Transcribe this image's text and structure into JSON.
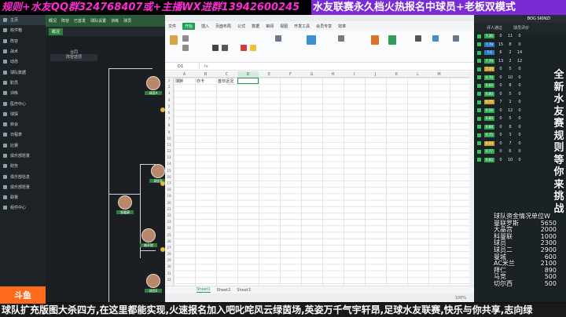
{
  "banner": {
    "left_text": "规则+水友QQ群324768407或+主播WX进群13942600245",
    "right_text": "水友联赛永久档火热报名中球员+老板双模式"
  },
  "sidebar": {
    "items": [
      {
        "label": "主页",
        "icon": "home-icon"
      },
      {
        "label": "收件箱",
        "icon": "inbox-icon"
      },
      {
        "label": "阵容",
        "icon": "squad-icon"
      },
      {
        "label": "战术",
        "icon": "tactics-icon"
      },
      {
        "label": "动态",
        "icon": "dynamics-icon"
      },
      {
        "label": "球队数据",
        "icon": "data-icon"
      },
      {
        "label": "职员",
        "icon": "staff-icon"
      },
      {
        "label": "训练",
        "icon": "training-icon"
      },
      {
        "label": "医疗中心",
        "icon": "medical-icon"
      },
      {
        "label": "球探",
        "icon": "scouting-icon"
      },
      {
        "label": "转会",
        "icon": "transfer-icon"
      },
      {
        "label": "日程表",
        "icon": "calendar-icon"
      },
      {
        "label": "比赛",
        "icon": "competitions-icon"
      },
      {
        "label": "俱乐部愿景",
        "icon": "vision-icon"
      },
      {
        "label": "财务",
        "icon": "finance-icon"
      },
      {
        "label": "俱乐部信息",
        "icon": "club-info-icon"
      },
      {
        "label": "俱乐部愿景",
        "icon": "vision2-icon"
      },
      {
        "label": "联赛",
        "icon": "league-icon"
      },
      {
        "label": "组件中心",
        "icon": "widgets-icon"
      }
    ],
    "logo_text": "斗鱼"
  },
  "game": {
    "tabs": [
      "概况",
      "阵容",
      "已首发",
      "球队设置",
      "训练",
      "球员"
    ],
    "subtab": "概况",
    "filter_label": "合同",
    "filter_value": "阵容选项",
    "players": [
      {
        "name": "球员A"
      },
      {
        "name": "球员B"
      },
      {
        "name": "张嘉豪"
      },
      {
        "name": "梅开地"
      },
      {
        "name": "球员E"
      }
    ]
  },
  "sheet": {
    "menu": [
      "文件",
      "开始",
      "插入",
      "页面布局",
      "公式",
      "数据",
      "审阅",
      "视图",
      "开发工具",
      "会员专享",
      "效率"
    ],
    "active_menu": "开始",
    "cell_ref": "D1",
    "fx": "fx",
    "columns": [
      "A",
      "B",
      "C",
      "D",
      "E",
      "F",
      "G",
      "H",
      "I",
      "J",
      "K",
      "L",
      "M"
    ],
    "selected_col": "D",
    "rows": [
      "1",
      "2",
      "3",
      "4",
      "5",
      "6",
      "7",
      "8",
      "9",
      "10",
      "11",
      "12",
      "13",
      "14",
      "15",
      "16",
      "17",
      "18",
      "19",
      "20",
      "21",
      "22",
      "23",
      "24",
      "25",
      "26",
      "27",
      "28",
      "29",
      "30",
      "31",
      "32"
    ],
    "cells": {
      "A1": "球胖",
      "B1": "亦卡",
      "C1": "首日近况"
    },
    "tabs": [
      "Sheet1",
      "Sheet2",
      "Sheet3"
    ],
    "active_tab": "Sheet1",
    "zoom": "100%"
  },
  "rpanel": {
    "header": "BOG SKINZI",
    "col_labels": [
      "评人通过",
      "球员评价"
    ],
    "rows": [
      {
        "rating": "7.36",
        "a": "0",
        "b": "11",
        "c": "0",
        "color": "#2fa84f"
      },
      {
        "rating": "7.79",
        "a": "15",
        "b": "8",
        "c": "0",
        "color": "#2a7ac7"
      },
      {
        "rating": "7.0",
        "a": "6",
        "b": "2",
        "c": "14",
        "color": "#2a7ac7"
      },
      {
        "rating": "7.79",
        "a": "13",
        "b": "2",
        "c": "12",
        "color": "#2fa84f"
      },
      {
        "rating": "7.14",
        "a": "0",
        "b": "5",
        "c": "0",
        "color": "#c9a227"
      },
      {
        "rating": "6.70",
        "a": "0",
        "b": "10",
        "c": "0",
        "color": "#2fa84f"
      },
      {
        "rating": "6.64",
        "a": "0",
        "b": "8",
        "c": "0",
        "color": "#2fa84f"
      },
      {
        "rating": "6.80",
        "a": "0",
        "b": "5",
        "c": "0",
        "color": "#2fa84f"
      },
      {
        "rating": "6.75",
        "a": "7",
        "b": "2",
        "c": "0",
        "color": "#c9a227"
      },
      {
        "rating": "6.58",
        "a": "0",
        "b": "12",
        "c": "0",
        "color": "#2fa84f"
      },
      {
        "rating": "6.80",
        "a": "0",
        "b": "5",
        "c": "0",
        "color": "#2fa84f"
      },
      {
        "rating": "6.88",
        "a": "0",
        "b": "8",
        "c": "0",
        "color": "#2fa84f"
      },
      {
        "rating": "6.75",
        "a": "0",
        "b": "3",
        "c": "0",
        "color": "#2fa84f"
      },
      {
        "rating": "6.50",
        "a": "0",
        "b": "7",
        "c": "0",
        "color": "#c9a227"
      },
      {
        "rating": "6.77",
        "a": "0",
        "b": "6",
        "c": "0",
        "color": "#2fa84f"
      },
      {
        "rating": "6.83",
        "a": "0",
        "b": "10",
        "c": "0",
        "color": "#2fa84f"
      }
    ]
  },
  "rules_vertical": "全新水友赛规则等你来挑战",
  "fund": {
    "title": "球队资金情况单位W",
    "items": [
      {
        "name": "曼联罗斯",
        "value": "5650"
      },
      {
        "name": "大晶宫",
        "value": "2000"
      },
      {
        "name": "科曼联",
        "value": "1000"
      },
      {
        "name": "球员",
        "value": "2300"
      },
      {
        "name": "球员二",
        "value": "2900"
      },
      {
        "name": "曼城",
        "value": "600"
      },
      {
        "name": "AC米兰",
        "value": "2100"
      },
      {
        "name": "拜仁",
        "value": "890"
      },
      {
        "name": "马竞",
        "value": "500"
      },
      {
        "name": "切尔西",
        "value": "500"
      }
    ]
  },
  "bottom_marquee": "球队扩充版图大杀四方,在这里都能实现,火速报名加入吧叱咤风云绿茵场,英姿万千气宇轩昂,足球水友联赛,快乐与你共享,志向绿"
}
